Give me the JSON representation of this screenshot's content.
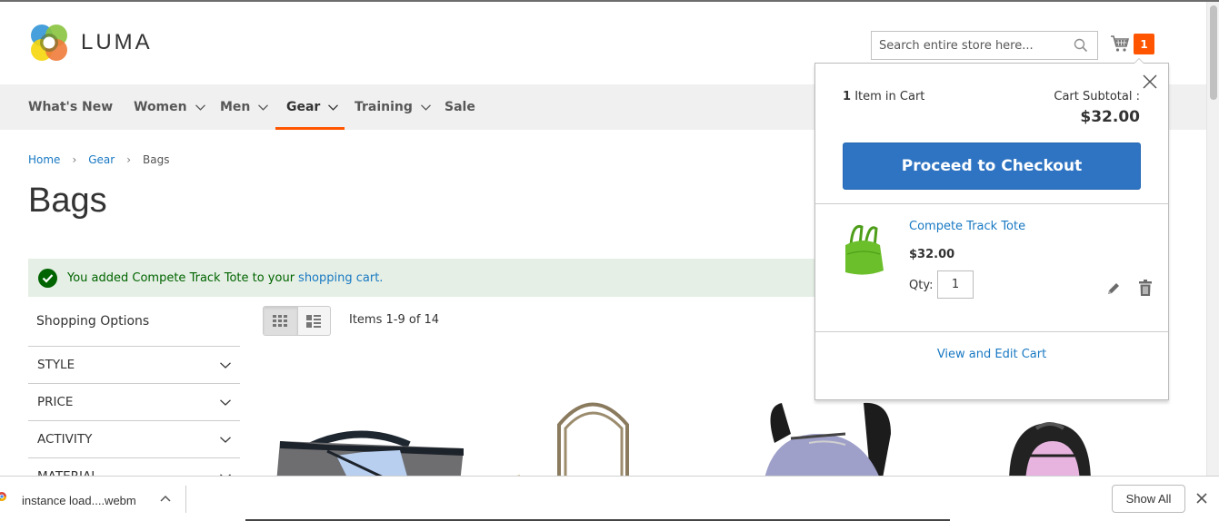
{
  "header": {
    "logo_text": "LUMA",
    "search_placeholder": "Search entire store here...",
    "cart_count": "1"
  },
  "nav": {
    "items": [
      {
        "label": "What's New",
        "has_dropdown": false,
        "active": false
      },
      {
        "label": "Women",
        "has_dropdown": true,
        "active": false
      },
      {
        "label": "Men",
        "has_dropdown": true,
        "active": false
      },
      {
        "label": "Gear",
        "has_dropdown": true,
        "active": true
      },
      {
        "label": "Training",
        "has_dropdown": true,
        "active": false
      },
      {
        "label": "Sale",
        "has_dropdown": false,
        "active": false
      }
    ]
  },
  "breadcrumb": {
    "items": [
      {
        "label": "Home"
      },
      {
        "label": "Gear"
      },
      {
        "label": "Bags"
      }
    ]
  },
  "page": {
    "title": "Bags"
  },
  "message": {
    "text": "You added Compete Track Tote to your",
    "link": "shopping cart."
  },
  "sidebar": {
    "title": "Shopping Options",
    "filters": [
      {
        "label": "STYLE"
      },
      {
        "label": "PRICE"
      },
      {
        "label": "ACTIVITY"
      },
      {
        "label": "MATERIAL"
      }
    ]
  },
  "toolbar": {
    "view_modes": [
      "grid",
      "list"
    ],
    "active_mode": "grid",
    "items_count": "Items 1-9 of 14"
  },
  "minicart": {
    "count_number": "1",
    "count_text": "Item in Cart",
    "subtotal_label": "Cart Subtotal :",
    "subtotal": "$32.00",
    "checkout_label": "Proceed to Checkout",
    "item": {
      "name": "Compete Track Tote",
      "price": "$32.00",
      "qty_label": "Qty:",
      "qty": "1"
    },
    "view_cart_label": "View and Edit Cart"
  },
  "download_bar": {
    "file_name": "instance load....webm",
    "show_all_label": "Show All"
  },
  "colors": {
    "accent": "#ff5501",
    "link": "#1979c3",
    "button": "#2f74c2",
    "success_bg": "#e5efe5",
    "success_text": "#006400"
  }
}
